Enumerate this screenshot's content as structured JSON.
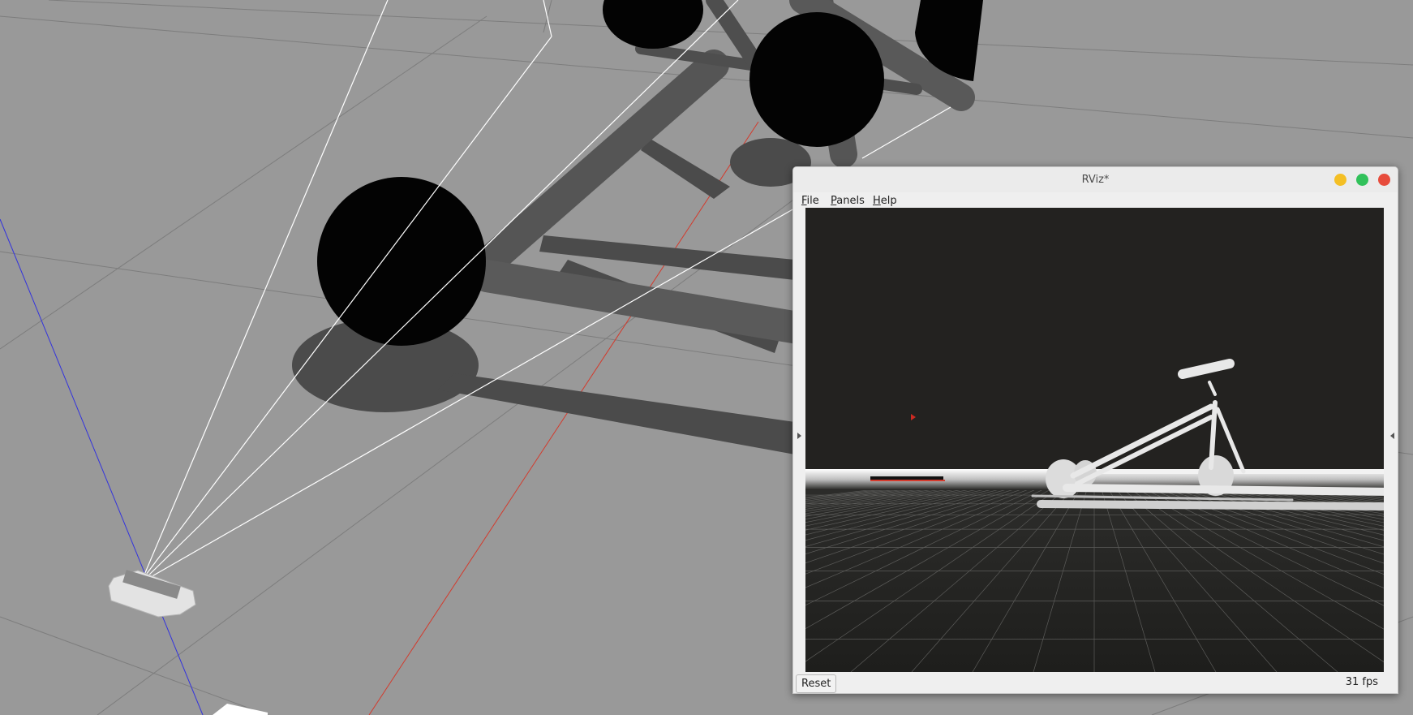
{
  "window": {
    "title": "RViz*",
    "menu": {
      "file": {
        "mnemonic": "F",
        "rest": "ile"
      },
      "panels": {
        "mnemonic": "P",
        "rest": "anels"
      },
      "help": {
        "mnemonic": "H",
        "rest": "elp"
      }
    },
    "reset_label": "Reset",
    "fps_text": "31 fps"
  },
  "colors": {
    "gazebo_floor": "#999999",
    "rviz_background": "#232220",
    "point_cloud": "#e8e8e8",
    "x_axis": "#d33a2c",
    "z_axis": "#3333dd"
  }
}
